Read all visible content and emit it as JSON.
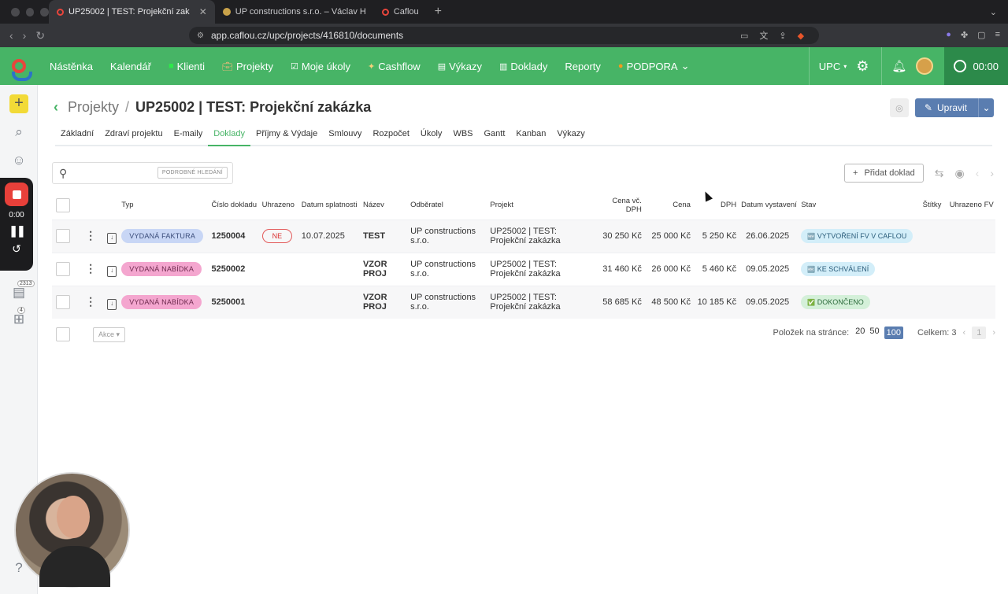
{
  "browser": {
    "tabs": [
      {
        "label": "UP25002 | TEST: Projekční zak",
        "active": true
      },
      {
        "label": "UP constructions s.r.o. – Václav H",
        "active": false
      },
      {
        "label": "Caflou",
        "active": false
      }
    ],
    "url": "app.caflou.cz/upc/projects/416810/documents"
  },
  "nav": {
    "items": [
      {
        "label": "Nástěnka",
        "icon": ""
      },
      {
        "label": "Kalendář",
        "icon": ""
      },
      {
        "label": "Klienti",
        "icon": "green-square-icon"
      },
      {
        "label": "Projekty",
        "icon": "briefcase-icon"
      },
      {
        "label": "Moje úkoly",
        "icon": "checkbox-icon"
      },
      {
        "label": "Cashflow",
        "icon": "money-icon"
      },
      {
        "label": "Výkazy",
        "icon": "clipboard-icon"
      },
      {
        "label": "Doklady",
        "icon": "receipt-icon"
      },
      {
        "label": "Reporty",
        "icon": ""
      },
      {
        "label": "PODPORA",
        "icon": "orange-dot-icon"
      }
    ],
    "company": "UPC",
    "timer": "00:00"
  },
  "rail": {
    "badge1": "2313",
    "badge2": "4"
  },
  "recorder": {
    "time": "0:00"
  },
  "breadcrumb": {
    "parent": "Projekty",
    "separator": "/",
    "title": "UP25002 | TEST: Projekční zakázka"
  },
  "edit_button": "Upravit",
  "tabs": [
    "Základní",
    "Zdraví projektu",
    "E-maily",
    "Doklady",
    "Příjmy & Výdaje",
    "Smlouvy",
    "Rozpočet",
    "Úkoly",
    "WBS",
    "Gantt",
    "Kanban",
    "Výkazy"
  ],
  "active_tab": "Doklady",
  "search": {
    "advanced": "PODROBNÉ HLEDÁNÍ"
  },
  "add_document": "Přidat doklad",
  "table": {
    "headers": [
      "Typ",
      "Číslo dokladu",
      "Uhrazeno",
      "Datum splatnosti",
      "Název",
      "Odběratel",
      "Projekt",
      "Cena vč. DPH",
      "Cena",
      "DPH",
      "Datum vystavení",
      "Stav",
      "Štítky",
      "Uhrazeno FV"
    ],
    "rows": [
      {
        "type": "VYDANÁ FAKTURA",
        "number": "1250004",
        "paid": "NE",
        "due": "10.07.2025",
        "name": "TEST",
        "customer": "UP constructions s.r.o.",
        "project": "UP25002 | TEST: Projekční zakázka",
        "total": "30 250 Kč",
        "price": "25 000 Kč",
        "vat": "5 250 Kč",
        "issued": "26.06.2025",
        "status": "VYTVOŘENÍ FV V CAFLOU",
        "status_icon": "🆕"
      },
      {
        "type": "VYDANÁ NABÍDKA",
        "number": "5250002",
        "paid": "",
        "due": "",
        "name": "VZOR PROJ",
        "customer": "UP constructions s.r.o.",
        "project": "UP25002 | TEST: Projekční zakázka",
        "total": "31 460 Kč",
        "price": "26 000 Kč",
        "vat": "5 460 Kč",
        "issued": "09.05.2025",
        "status": "KE SCHVÁLENÍ",
        "status_icon": "🔤"
      },
      {
        "type": "VYDANÁ NABÍDKA",
        "number": "5250001",
        "paid": "",
        "due": "",
        "name": "VZOR PROJ",
        "customer": "UP constructions s.r.o.",
        "project": "UP25002 | TEST: Projekční zakázka",
        "total": "58 685 Kč",
        "price": "48 500 Kč",
        "vat": "10 185 Kč",
        "issued": "09.05.2025",
        "status": "DOKONČENO",
        "status_icon": "✅"
      }
    ]
  },
  "footer": {
    "actions": "Akce",
    "per_page_label": "Položek na stránce:",
    "per_page": [
      "20",
      "50",
      "100"
    ],
    "per_page_selected": "100",
    "total": "Celkem: 3",
    "page": "1"
  }
}
